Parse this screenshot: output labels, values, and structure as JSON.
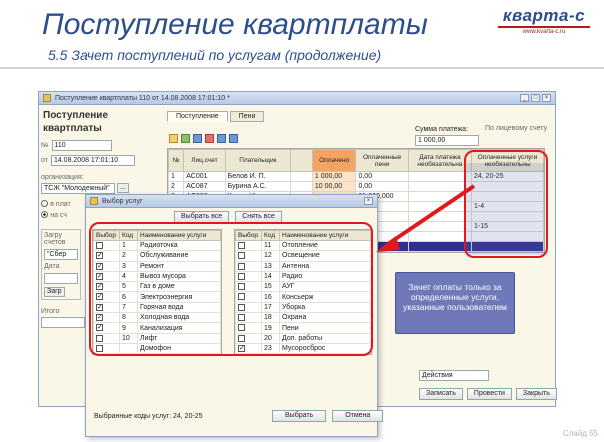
{
  "slide": {
    "title": "Поступление квартплаты",
    "subtitle": "5.5  Зачет поступлений по услугам (продолжение)",
    "logo_main": "кварта-с",
    "logo_sub": "www.kvarta-c.ru",
    "page_number": "Слайд 55"
  },
  "main_window": {
    "title": "Поступление квартплаты 110 от 14.08.2008 17:01:10 *",
    "tabs": [
      "Поступление",
      "Пени"
    ],
    "doc_title_1": "Поступление",
    "doc_title_2": "квартплаты",
    "number_label": "№",
    "number_value": "110",
    "from_label": "от",
    "date_value": "14.08.2008 17:01:10",
    "org_label": "организация:",
    "org_value": "ТСЖ \"Молодежный\"",
    "radio_1": "в плат",
    "radio_2": "на сч",
    "group_label": "Загру",
    "group_field": "счетов",
    "field_a": "\"Сбер",
    "field_b": "Дата",
    "field_c": "Загр",
    "comment_label": "Итого",
    "sum_label": "Сумма платежа:",
    "sum_value": "1 000,00",
    "unit_note": "По лицевому счету",
    "action_label": "Действия",
    "buttons": {
      "record": "Записать",
      "post": "Провести",
      "close": "Закрыть"
    }
  },
  "main_grid": {
    "headers": [
      "№",
      "Лиц.счет",
      "Плательщик",
      "",
      "Оплачено",
      "Оплаченные пени",
      "Дата платежа необязательна",
      "Оплаченные услуги необязательны"
    ],
    "rows": [
      [
        "1",
        "АС001",
        "Белов И. П.",
        "",
        "1 000,00",
        "0,00",
        "",
        "24, 20-25"
      ],
      [
        "2",
        "АС087",
        "Бурина А.С.",
        "",
        "10 00,00",
        "0,00",
        "",
        ""
      ],
      [
        "3",
        "АС092",
        "Кожин И.",
        "",
        "",
        "01,000,000",
        "",
        ""
      ],
      [
        "4",
        "",
        "",
        "",
        "",
        "",
        "",
        "1-4"
      ],
      [
        "5",
        "",
        "",
        "",
        "",
        "",
        "",
        ""
      ],
      [
        "6",
        "",
        "",
        "",
        "",
        "",
        "",
        "1-15"
      ],
      [
        "7",
        "",
        "",
        "",
        "",
        "",
        "",
        ""
      ],
      [
        "8",
        "",
        "",
        "",
        "",
        "",
        "",
        ""
      ]
    ]
  },
  "popup": {
    "title": "Выбор услуг",
    "toolbar_btn1": "Выбрать все",
    "toolbar_btn2": "Снять все",
    "headers_left": [
      "Выбор",
      "Код",
      "Наименование услуги"
    ],
    "headers_right": [
      "Выбор",
      "Код",
      "Наименование услуги"
    ],
    "rows_left": [
      {
        "checked": false,
        "code": "1",
        "name": "Радиоточка"
      },
      {
        "checked": true,
        "code": "2",
        "name": "Обслуживание"
      },
      {
        "checked": true,
        "code": "3",
        "name": "Ремонт"
      },
      {
        "checked": true,
        "code": "4",
        "name": "Вывоз мусора"
      },
      {
        "checked": true,
        "code": "5",
        "name": "Газ в доме"
      },
      {
        "checked": true,
        "code": "6",
        "name": "Электроэнергия"
      },
      {
        "checked": true,
        "code": "7",
        "name": "Горячая вода"
      },
      {
        "checked": true,
        "code": "8",
        "name": "Холодная вода"
      },
      {
        "checked": true,
        "code": "9",
        "name": "Канализация"
      },
      {
        "checked": false,
        "code": "10",
        "name": "Лифт"
      },
      {
        "checked": false,
        "code": "",
        "name": "Домофон"
      }
    ],
    "rows_right": [
      {
        "checked": false,
        "code": "11",
        "name": "Отопление"
      },
      {
        "checked": false,
        "code": "12",
        "name": "Освещение"
      },
      {
        "checked": false,
        "code": "13",
        "name": "Антенна"
      },
      {
        "checked": false,
        "code": "14",
        "name": "Радио"
      },
      {
        "checked": false,
        "code": "15",
        "name": "АУГ"
      },
      {
        "checked": false,
        "code": "16",
        "name": "Консьерж"
      },
      {
        "checked": false,
        "code": "17",
        "name": "Уборка"
      },
      {
        "checked": false,
        "code": "18",
        "name": "Охрана"
      },
      {
        "checked": false,
        "code": "19",
        "name": "Пени"
      },
      {
        "checked": false,
        "code": "20",
        "name": "Доп. работы"
      },
      {
        "checked": true,
        "code": "23",
        "name": "Мусоросброс"
      }
    ],
    "footer_label": "Выбранные коды услуг:",
    "footer_value": "24, 20-25",
    "btn_choose": "Выбрать",
    "btn_cancel": "Отмена"
  },
  "callout": {
    "text": "Зачет оплаты только за определенные услуги, указанные пользователем"
  },
  "colors": {
    "title_blue": "#2c4f8c",
    "annotation_red": "#e0191c",
    "callout_bg": "#6f79b9",
    "selected_row": "#30308d"
  }
}
